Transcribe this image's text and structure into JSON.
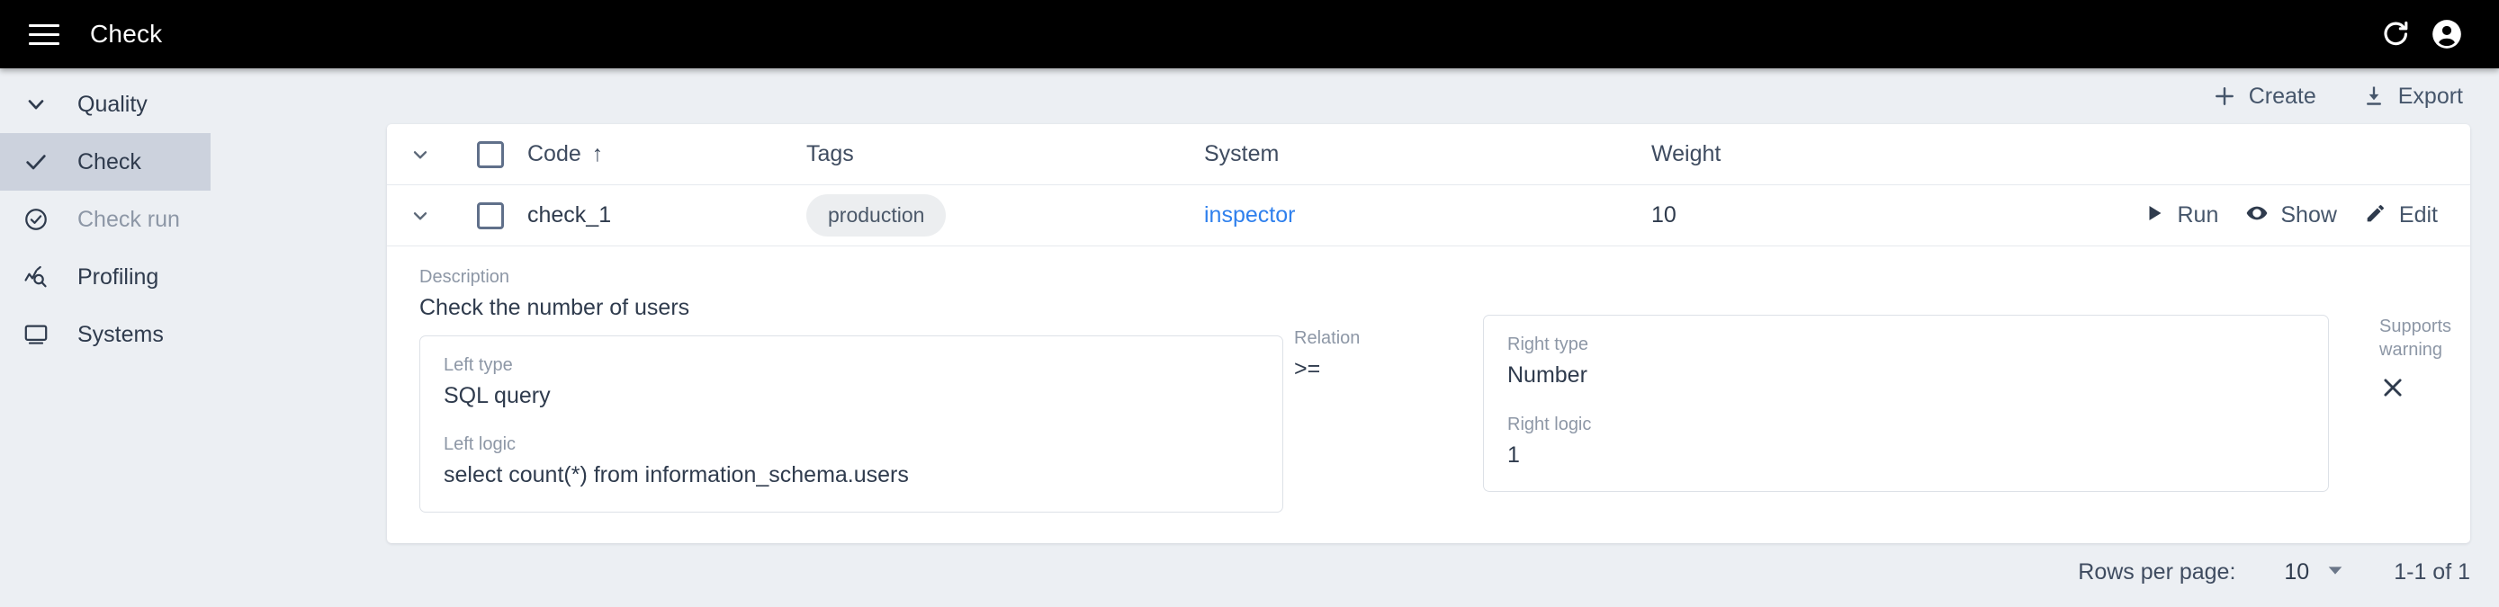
{
  "topbar": {
    "menu_icon": "hamburger-menu-icon",
    "title": "Check",
    "refresh_icon": "refresh-icon",
    "account_icon": "account-circle-icon"
  },
  "sidebar": {
    "items": [
      {
        "label": "Quality",
        "icon": "chevron-down-icon",
        "selected": false,
        "muted": false
      },
      {
        "label": "Check",
        "icon": "check-icon",
        "selected": true,
        "muted": false
      },
      {
        "label": "Check run",
        "icon": "check-circle-icon",
        "selected": false,
        "muted": true
      },
      {
        "label": "Profiling",
        "icon": "profiling-icon",
        "selected": false,
        "muted": false
      },
      {
        "label": "Systems",
        "icon": "monitor-icon",
        "selected": false,
        "muted": false
      }
    ]
  },
  "toolbar": {
    "create_label": "Create",
    "create_icon": "plus-icon",
    "export_label": "Export",
    "export_icon": "download-icon"
  },
  "table": {
    "columns": {
      "code": "Code",
      "code_sort": "↑",
      "tags": "Tags",
      "system": "System",
      "weight": "Weight"
    },
    "row": {
      "code": "check_1",
      "tag": "production",
      "system": "inspector",
      "weight": "10",
      "actions": [
        {
          "label": "Run",
          "icon": "play-icon"
        },
        {
          "label": "Show",
          "icon": "eye-icon"
        },
        {
          "label": "Edit",
          "icon": "pencil-icon"
        }
      ]
    },
    "detail": {
      "description_label": "Description",
      "description_value": "Check the number of users",
      "left_type_label": "Left type",
      "left_type_value": "SQL query",
      "left_logic_label": "Left logic",
      "left_logic_value": "select count(*) from information_schema.users",
      "relation_label": "Relation",
      "relation_value": ">=",
      "right_type_label": "Right type",
      "right_type_value": "Number",
      "right_logic_label": "Right logic",
      "right_logic_value": "1",
      "supports_warning_label": "Supports warning",
      "supports_warning_icon": "close-x-icon"
    }
  },
  "footer": {
    "rows_per_page_label": "Rows per page:",
    "rows_per_page_value": "10",
    "rows_per_page_icon": "caret-down-icon",
    "range_label": "1-1 of 1"
  },
  "colors": {
    "topbar_bg": "#000000",
    "page_bg": "#eceff3",
    "selected_nav_bg": "#ccd2dd",
    "link": "#2f80ed",
    "text": "#2f3b4d",
    "muted_text": "#8d97a6"
  }
}
